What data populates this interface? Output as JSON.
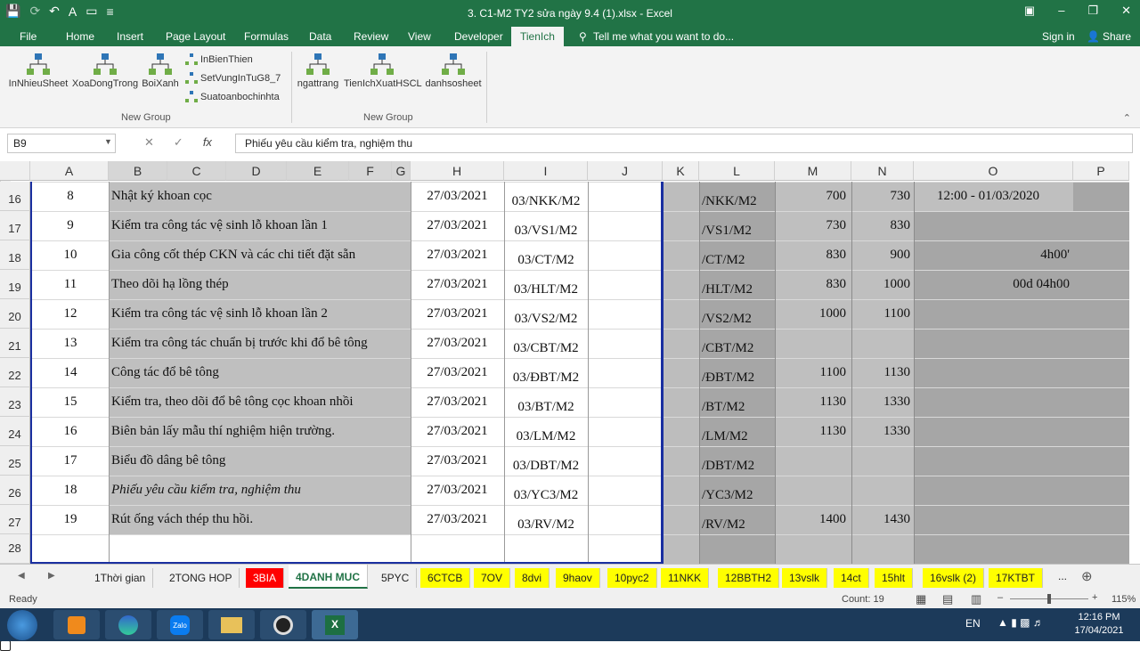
{
  "window": {
    "title": "3. C1-M2 TY2 sửa ngày 9.4 (1).xlsx - Excel"
  },
  "menu": [
    "File",
    "Home",
    "Insert",
    "Page Layout",
    "Formulas",
    "Data",
    "Review",
    "View",
    "Developer",
    "TienIch"
  ],
  "tell_me": "Tell me what you want to do...",
  "signin": "Sign in",
  "share": "Share",
  "ribbon": {
    "group1": {
      "label": "New Group",
      "buttons": [
        "InNhieuSheet",
        "XoaDongTrong",
        "BoiXanh"
      ],
      "small": [
        "InBienThien",
        "SetVungInTuG8_7",
        "Suatoanbochinhta"
      ]
    },
    "group2": {
      "label": "New Group",
      "buttons": [
        "ngattrang",
        "TienIchXuatHSCL",
        "danhsosheet"
      ]
    }
  },
  "formula_bar": {
    "name_box": "B9",
    "fx": "fx",
    "content": "Phiếu yêu cầu kiểm tra, nghiệm thu"
  },
  "columns": [
    "A",
    "B",
    "C",
    "D",
    "E",
    "F",
    "G",
    "H",
    "I",
    "J",
    "K",
    "L",
    "M",
    "N",
    "O",
    "P"
  ],
  "rows": [
    {
      "r": "16",
      "a": "8",
      "b": "Nhật ký khoan cọc",
      "h": "27/03/2021",
      "i": "03/NKK/M2",
      "l": "/NKK/M2",
      "m": "700",
      "n": "730",
      "o": "12:00 - 01/03/2020"
    },
    {
      "r": "17",
      "a": "9",
      "b": "Kiểm tra công tác vệ sinh lỗ khoan lần 1",
      "h": "27/03/2021",
      "i": "03/VS1/M2",
      "l": "/VS1/M2",
      "m": "730",
      "n": "830",
      "o": ""
    },
    {
      "r": "18",
      "a": "10",
      "b": "Gia công cốt thép CKN và các chi tiết đặt sẵn",
      "h": "27/03/2021",
      "i": "03/CT/M2",
      "l": "/CT/M2",
      "m": "830",
      "n": "900",
      "o": "4h00'"
    },
    {
      "r": "19",
      "a": "11",
      "b": "Theo dõi hạ lồng thép",
      "h": "27/03/2021",
      "i": "03/HLT/M2",
      "l": "/HLT/M2",
      "m": "830",
      "n": "1000",
      "o": "00d 04h00"
    },
    {
      "r": "20",
      "a": "12",
      "b": "Kiểm tra công tác vệ sinh lỗ khoan lần 2",
      "h": "27/03/2021",
      "i": "03/VS2/M2",
      "l": "/VS2/M2",
      "m": "1000",
      "n": "1100",
      "o": ""
    },
    {
      "r": "21",
      "a": "13",
      "b": "Kiểm tra công tác chuẩn bị trước khi đổ bê tông",
      "h": "27/03/2021",
      "i": "03/CBT/M2",
      "l": "/CBT/M2",
      "m": "",
      "n": "",
      "o": ""
    },
    {
      "r": "22",
      "a": "14",
      "b": "Công tác đổ bê tông",
      "h": "27/03/2021",
      "i": "03/ĐBT/M2",
      "l": "/ĐBT/M2",
      "m": "1100",
      "n": "1130",
      "o": ""
    },
    {
      "r": "23",
      "a": "15",
      "b": "Kiểm tra, theo dõi đổ bê tông cọc khoan nhồi",
      "h": "27/03/2021",
      "i": "03/BT/M2",
      "l": "/BT/M2",
      "m": "1130",
      "n": "1330",
      "o": ""
    },
    {
      "r": "24",
      "a": "16",
      "b": "Biên bản lấy mẫu thí nghiệm hiện trường.",
      "h": "27/03/2021",
      "i": "03/LM/M2",
      "l": "/LM/M2",
      "m": "1130",
      "n": "1330",
      "o": ""
    },
    {
      "r": "25",
      "a": "17",
      "b": "Biểu đồ dâng bê tông",
      "h": "27/03/2021",
      "i": "03/DBT/M2",
      "l": "/DBT/M2",
      "m": "",
      "n": "",
      "o": ""
    },
    {
      "r": "26",
      "a": "18",
      "b": "Phiếu yêu cầu kiểm tra, nghiệm thu",
      "h": "27/03/2021",
      "i": "03/YC3/M2",
      "l": "/YC3/M2",
      "m": "",
      "n": "",
      "o": ""
    },
    {
      "r": "27",
      "a": "19",
      "b": "Rút ống vách thép thu hồi.",
      "h": "27/03/2021",
      "i": "03/RV/M2",
      "l": "/RV/M2",
      "m": "1400",
      "n": "1430",
      "o": ""
    },
    {
      "r": "28",
      "a": "",
      "b": "",
      "h": "",
      "i": "",
      "l": "",
      "m": "",
      "n": "",
      "o": ""
    }
  ],
  "sheets": [
    {
      "label": "1Thời gian",
      "color": "#f0f0f0"
    },
    {
      "label": "2TONG HOP",
      "color": "#f0f0f0"
    },
    {
      "label": "3BIA",
      "color": "#ff0000"
    },
    {
      "label": "4DANH MUC",
      "color": "#ffffff"
    },
    {
      "label": "5PYC",
      "color": "#f0f0f0"
    },
    {
      "label": "6CTCB",
      "color": "#ffff00"
    },
    {
      "label": "7OV",
      "color": "#ffff00"
    },
    {
      "label": "8dvi",
      "color": "#ffff00"
    },
    {
      "label": "9haov",
      "color": "#ffff00"
    },
    {
      "label": "10pyc2",
      "color": "#ffff00"
    },
    {
      "label": "11NKK",
      "color": "#ffff00"
    },
    {
      "label": "12BBTH2",
      "color": "#ffff00"
    },
    {
      "label": "13vslk",
      "color": "#ffff00"
    },
    {
      "label": "14ct",
      "color": "#ffff00"
    },
    {
      "label": "15hlt",
      "color": "#ffff00"
    },
    {
      "label": "16vslk (2)",
      "color": "#ffff00"
    },
    {
      "label": "17KTBT",
      "color": "#ffff00"
    }
  ],
  "status": {
    "ready": "Ready",
    "count": "Count: 19",
    "zoom": "115%"
  },
  "taskbar": {
    "lang": "EN",
    "time": "12:16 PM",
    "date": "17/04/2021"
  }
}
